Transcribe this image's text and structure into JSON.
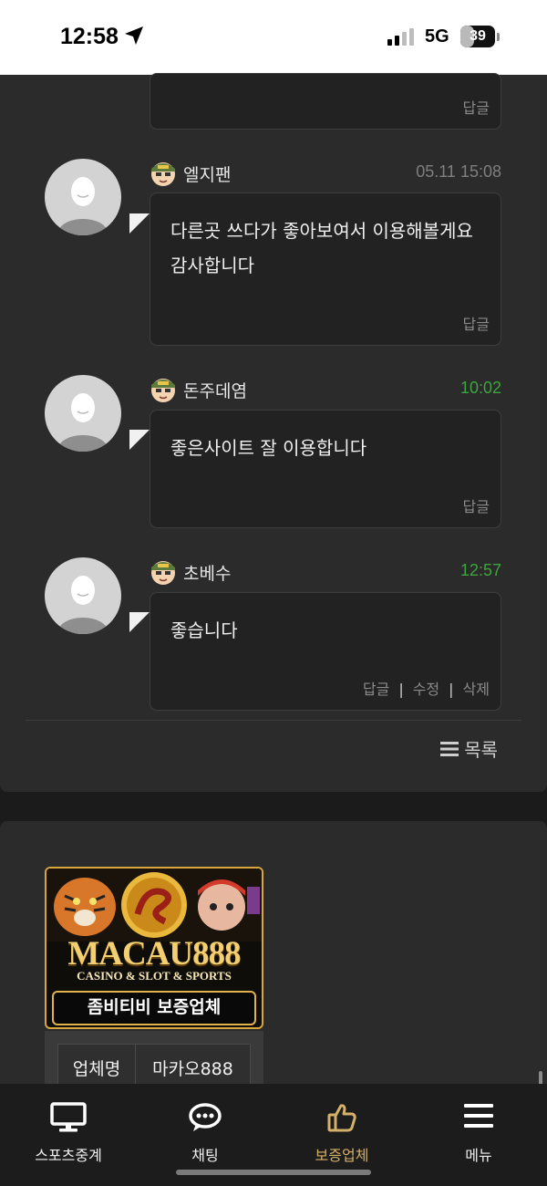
{
  "status_bar": {
    "time": "12:58",
    "network": "5G",
    "battery": "39",
    "battery_level": 0.39
  },
  "comments": [
    {
      "actions": [
        "답글"
      ]
    },
    {
      "nickname": "엘지팬",
      "time": "05.11 15:08",
      "text": "다른곳 쓰다가 좋아보여서 이용해볼게요 감사합니다",
      "actions": [
        "답글"
      ]
    },
    {
      "nickname": "돈주데염",
      "time": "10:02",
      "text": "좋은사이트 잘 이용합니다",
      "actions": [
        "답글"
      ]
    },
    {
      "nickname": "초베수",
      "time": "12:57",
      "text": "좋습니다",
      "actions": [
        "답글",
        "수정",
        "삭제"
      ]
    }
  ],
  "list_button": "목록",
  "ad": {
    "brand": "MACAU888",
    "tagline": "CASINO & SLOT & SPORTS",
    "cert_label": "좀비티비 보증업체",
    "table": {
      "header": "업체명",
      "value": "마카오888"
    }
  },
  "bottom_nav": [
    {
      "label": "스포츠중계",
      "icon": "monitor-icon"
    },
    {
      "label": "채팅",
      "icon": "chat-bubble-icon"
    },
    {
      "label": "보증업체",
      "icon": "thumbs-up-icon",
      "active": true
    },
    {
      "label": "메뉴",
      "icon": "hamburger-menu-icon"
    }
  ],
  "colors": {
    "accent": "#d4b06a",
    "time_green": "#3ea53e",
    "banner_gold": "#d8a63c"
  }
}
